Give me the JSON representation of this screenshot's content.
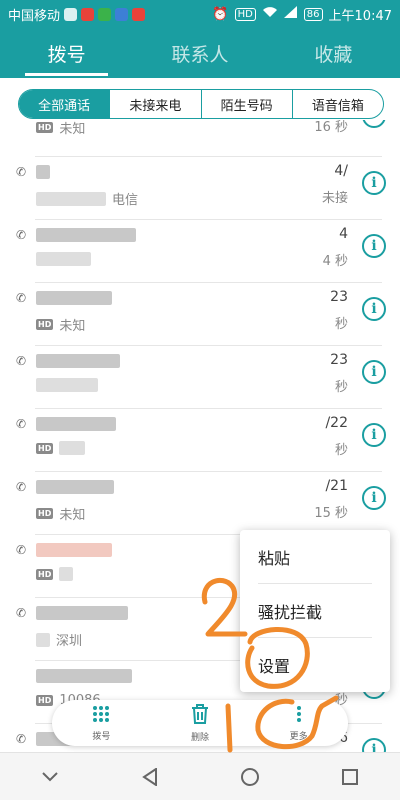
{
  "status_bar": {
    "carrier": "中国移动",
    "signal_badge": "HD",
    "battery": "86",
    "time": "上午10:47"
  },
  "tabs": [
    {
      "label": "拨号",
      "active": true
    },
    {
      "label": "联系人",
      "active": false
    },
    {
      "label": "收藏",
      "active": false
    }
  ],
  "filters": [
    {
      "label": "全部通话",
      "active": true
    },
    {
      "label": "未接来电",
      "active": false
    },
    {
      "label": "陌生号码",
      "active": false
    },
    {
      "label": "语音信箱",
      "active": false
    }
  ],
  "calls": [
    {
      "name": "",
      "hd": "HD",
      "location": "未知",
      "time": "",
      "duration": "16 秒"
    },
    {
      "name": "",
      "hd": "",
      "location": "电信",
      "time": "4/",
      "duration": "未接"
    },
    {
      "name": "",
      "hd": "",
      "location": "",
      "time": "4",
      "duration": "4 秒"
    },
    {
      "name": "",
      "hd": "HD",
      "location": "未知",
      "time": "23",
      "duration": "秒"
    },
    {
      "name": "",
      "hd": "",
      "location": "",
      "time": "23",
      "duration": "秒"
    },
    {
      "name": "",
      "hd": "HD",
      "location": "",
      "time": "/22",
      "duration": "秒"
    },
    {
      "name": "",
      "hd": "HD",
      "location": "未知",
      "time": "/21",
      "duration": "15 秒"
    },
    {
      "name": "",
      "hd": "HD",
      "location": "",
      "time": "",
      "duration": ""
    },
    {
      "name": "",
      "hd": "",
      "location": "深圳",
      "time": "",
      "duration": ""
    },
    {
      "name": "",
      "hd": "HD",
      "location": "10086",
      "time": "",
      "duration": "秒"
    },
    {
      "name": "",
      "hd": "",
      "location": "",
      "time": "4/16",
      "duration": ""
    }
  ],
  "menu": {
    "items": [
      "粘贴",
      "骚扰拦截",
      "设置"
    ]
  },
  "toolbar": {
    "dial_label": "拨号",
    "delete_label": "删除",
    "more_label": "更多"
  },
  "annotations": {
    "numbers": [
      "2",
      "1"
    ],
    "color": "#f08a2c"
  },
  "colors": {
    "accent": "#1a9ea1"
  }
}
